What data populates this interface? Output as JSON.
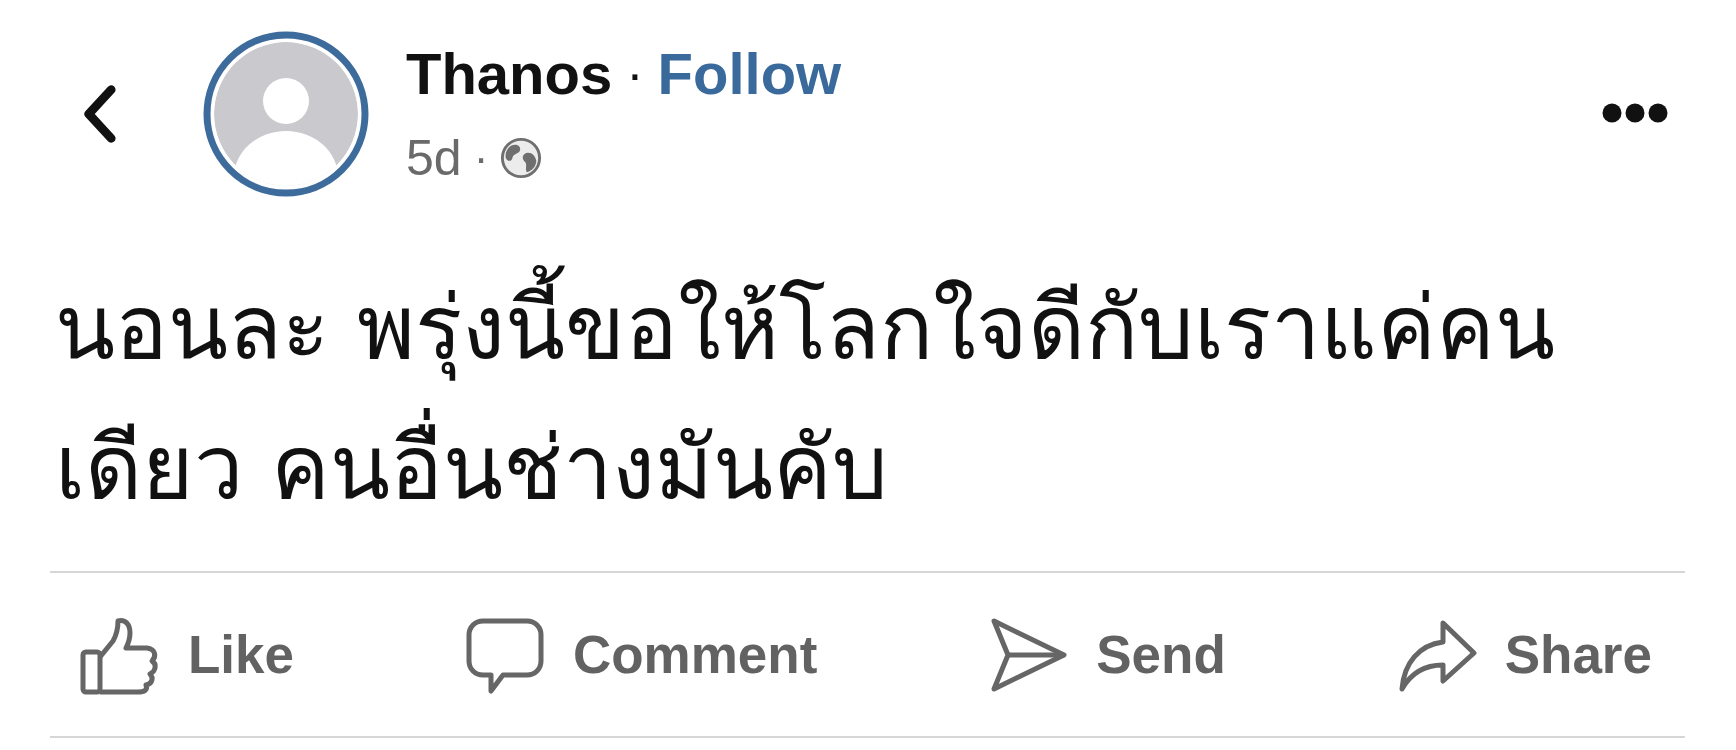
{
  "header": {
    "author": "Thanos",
    "separator": "·",
    "follow": "Follow",
    "time": "5d",
    "time_separator": "·"
  },
  "post_text": "นอนละ พรุ่งนี้ขอให้โลกใจดีกับเราแค่คนเดียว คนอื่นช่างมันคับ",
  "actions": [
    {
      "kind": "like",
      "label": "Like"
    },
    {
      "kind": "comment",
      "label": "Comment"
    },
    {
      "kind": "send",
      "label": "Send"
    },
    {
      "kind": "share",
      "label": "Share"
    }
  ]
}
